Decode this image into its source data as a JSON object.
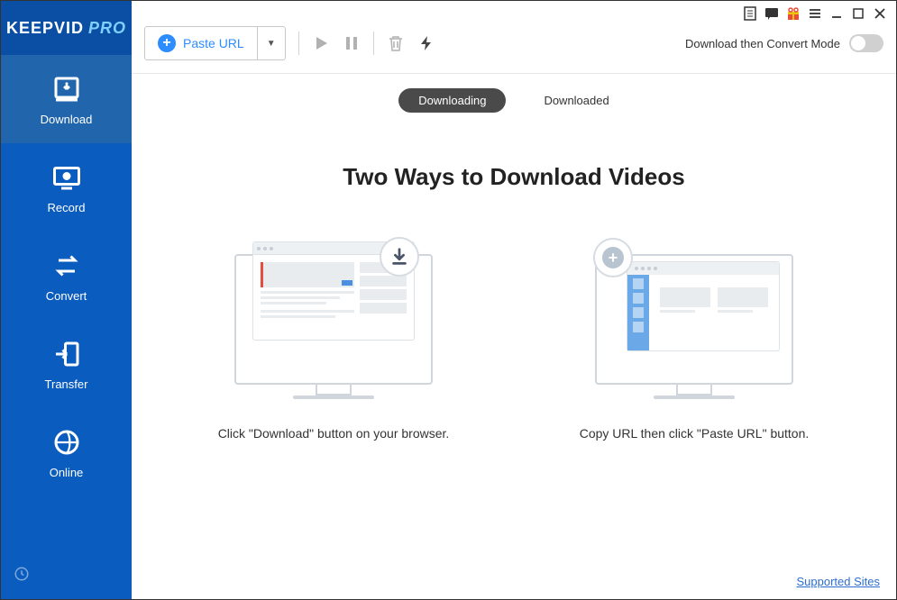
{
  "logo": {
    "brand": "KEEPVID",
    "suffix": "PRO"
  },
  "sidebar": {
    "items": [
      {
        "label": "Download"
      },
      {
        "label": "Record"
      },
      {
        "label": "Convert"
      },
      {
        "label": "Transfer"
      },
      {
        "label": "Online"
      }
    ]
  },
  "toolbar": {
    "paste_label": "Paste URL",
    "convert_mode_label": "Download then Convert Mode"
  },
  "tabs": {
    "downloading": "Downloading",
    "downloaded": "Downloaded"
  },
  "content": {
    "title": "Two Ways to Download Videos",
    "way1_caption": "Click \"Download\" button on your browser.",
    "way2_caption": "Copy URL then click \"Paste URL\" button."
  },
  "footer": {
    "supported_sites": "Supported Sites"
  }
}
